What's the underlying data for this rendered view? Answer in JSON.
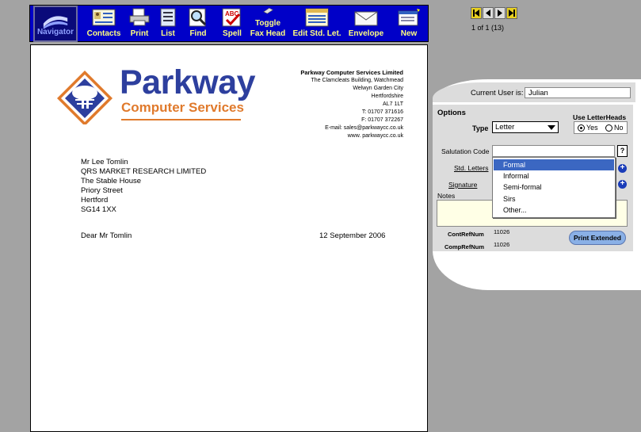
{
  "toolbar": {
    "buttons": [
      {
        "label": "Navigator",
        "icon": "navigator-icon"
      },
      {
        "label": "Contacts",
        "icon": "contacts-icon"
      },
      {
        "label": "Print",
        "icon": "printer-icon"
      },
      {
        "label": "List",
        "icon": "list-icon"
      },
      {
        "label": "Find",
        "icon": "find-icon"
      },
      {
        "label": "Spell",
        "icon": "spell-check-icon"
      },
      {
        "label": "Toggle",
        "label2": "Fax Head",
        "icon": "toggle-icon"
      },
      {
        "label": "Edit Std. Let.",
        "icon": "edit-letter-icon"
      },
      {
        "label": "Envelope",
        "icon": "envelope-icon"
      },
      {
        "label": "New",
        "icon": "new-document-icon"
      }
    ]
  },
  "record_nav": {
    "count": "1 of 1 (13)"
  },
  "letter": {
    "logo_line1": "Parkway",
    "logo_line2": "Computer Services",
    "company": {
      "name": "Parkway Computer Services Limited",
      "lines": [
        "The Clamcleats Building, Watchmead",
        "Welwyn Garden City",
        "Hertfordshire",
        "AL7 1LT",
        "T: 01707 371616",
        "F: 01707 372267",
        "E-mail: sales@parkwaycc.co.uk",
        "www. parkwaycc.co.uk"
      ]
    },
    "address": [
      "Mr Lee Tomlin",
      "QRS MARKET RESEARCH LIMITED",
      "The Stable House",
      "Priory Street",
      "Hertford",
      "SG14 1XX"
    ],
    "salutation": "Dear Mr Tomlin",
    "date": "12 September 2006"
  },
  "panel": {
    "current_user_label": "Current User is:",
    "current_user": "Julian",
    "options_heading": "Options",
    "type_label": "Type",
    "type_value": "Letter",
    "letterheads_label": "Use LetterHeads",
    "yes": "Yes",
    "no": "No",
    "letterheads_selected": "Yes",
    "salutation_code_label": "Salutation Code",
    "help": "?",
    "std_letters_label": "Std. Letters",
    "signature_label": "Signature",
    "notes_label": "Notes",
    "contref_label": "ContRefNum",
    "contref_value": "11026",
    "compref_label": "CompRefNum",
    "compref_value": "11026",
    "print_button": "Print Extended"
  },
  "salutation_dropdown": {
    "options": [
      "Formal",
      "Informal",
      "Semi-formal",
      "Sirs",
      "Other..."
    ],
    "selected": "Formal"
  },
  "colors": {
    "toolbar_bg": "#0000c8",
    "toolbar_label": "#ffff80",
    "brand_blue": "#2d3f9e",
    "brand_orange": "#e07a2c",
    "dropdown_selected": "#3b67c2"
  }
}
